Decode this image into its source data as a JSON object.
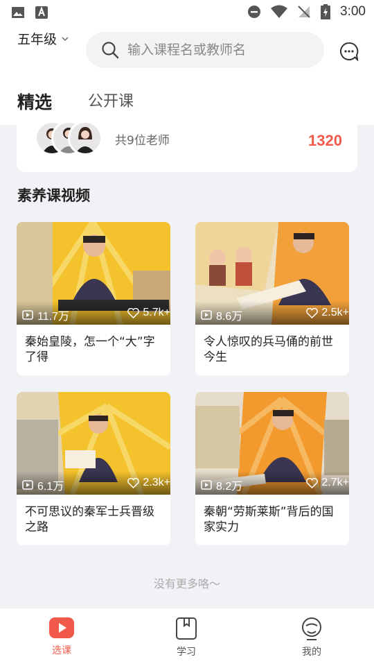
{
  "status_bar": {
    "time": "3:00"
  },
  "header": {
    "grade": "五年级",
    "search_placeholder": "输入课程名或教师名",
    "tabs": [
      {
        "label": "精选",
        "active": true
      },
      {
        "label": "公开课",
        "active": false
      }
    ]
  },
  "teachers": {
    "count_text": "共9位老师",
    "number": "1320"
  },
  "section": {
    "title": "素养课视频"
  },
  "videos": [
    {
      "title": "秦始皇陵，怎一个“大”字了得",
      "views": "11.7万",
      "likes": "5.7k+"
    },
    {
      "title": "令人惊叹的兵马俑的前世今生",
      "views": "8.6万",
      "likes": "2.5k+"
    },
    {
      "title": "不可思议的秦军士兵晋级之路",
      "views": "6.1万",
      "likes": "2.3k+"
    },
    {
      "title": "秦朝“劳斯莱斯”背后的国家实力",
      "views": "8.2万",
      "likes": "2.7k+"
    }
  ],
  "footer": {
    "no_more": "没有更多咯〜"
  },
  "bottom_nav": [
    {
      "label": "选课",
      "active": true,
      "icon": "play-icon"
    },
    {
      "label": "学习",
      "active": false,
      "icon": "book-icon"
    },
    {
      "label": "我的",
      "active": false,
      "icon": "profile-icon"
    }
  ],
  "colors": {
    "accent": "#f15a4a",
    "background": "#f1f2f6"
  }
}
